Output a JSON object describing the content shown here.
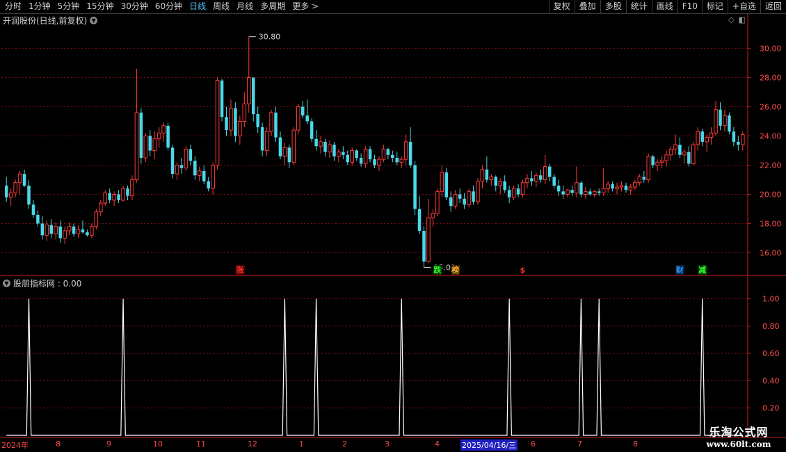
{
  "toolbar": {
    "periods": [
      "分时",
      "1分钟",
      "5分钟",
      "15分钟",
      "30分钟",
      "60分钟",
      "日线",
      "周线",
      "月线",
      "多周期",
      "更多 >"
    ],
    "active_period": "日线",
    "actions": [
      "复权",
      "叠加",
      "多股",
      "统计",
      "画线",
      "F10",
      "标记",
      "+自选",
      "返回"
    ]
  },
  "stock": {
    "title": "开润股份(日线,前复权)",
    "high_label": "30.80",
    "low_label": "15.01"
  },
  "indicator": {
    "title": "股朋指标网 : 0.00"
  },
  "price_axis": [
    "30.00",
    "28.00",
    "26.00",
    "24.00",
    "22.00",
    "20.00",
    "18.00",
    "16.00"
  ],
  "indicator_axis": [
    "1.00",
    "0.80",
    "0.60",
    "0.40",
    "0.20"
  ],
  "date_axis": [
    "2024年",
    "8",
    "9",
    "10",
    "11",
    "12",
    "1",
    "2",
    "3",
    "4",
    "2025/04/16/三",
    "6",
    "7",
    "8"
  ],
  "event_markers": [
    {
      "label": "涨",
      "color": "#ff3030",
      "bg": "#4a0000"
    },
    {
      "label": "跌",
      "color": "#30ff30",
      "bg": "#003a00"
    },
    {
      "label": "榜",
      "color": "#ffb030",
      "bg": "#3a2400"
    },
    {
      "label": "$",
      "color": "#ff3030",
      "bg": "#000000"
    },
    {
      "label": "财",
      "color": "#30a0ff",
      "bg": "#001a3a"
    },
    {
      "label": "减",
      "color": "#30ff30",
      "bg": "#003a00"
    }
  ],
  "watermark": {
    "line1": "乐淘公式网",
    "line2": "www.60lt.com"
  },
  "colors": {
    "up": "#ff3c3c",
    "down": "#4ad8e8",
    "grid": "#7a1010",
    "axis": "#c02020"
  },
  "chart_data": {
    "type": "candlestick",
    "y_range": [
      14.5,
      31.5
    ],
    "candles": [
      [
        20.6,
        21.2,
        19.5,
        19.8
      ],
      [
        19.8,
        20.4,
        19.2,
        20.1
      ],
      [
        20.1,
        21.0,
        19.8,
        20.8
      ],
      [
        20.8,
        21.6,
        20.0,
        21.4
      ],
      [
        21.4,
        21.7,
        20.5,
        20.6
      ],
      [
        20.6,
        21.0,
        19.0,
        19.3
      ],
      [
        19.3,
        19.6,
        18.4,
        18.6
      ],
      [
        18.6,
        18.9,
        17.8,
        18.0
      ],
      [
        18.0,
        18.5,
        16.9,
        17.2
      ],
      [
        17.2,
        18.2,
        16.8,
        17.9
      ],
      [
        17.9,
        18.3,
        17.0,
        17.3
      ],
      [
        17.3,
        18.1,
        16.9,
        17.8
      ],
      [
        17.8,
        18.2,
        16.7,
        17.0
      ],
      [
        17.0,
        17.8,
        16.6,
        17.5
      ],
      [
        17.5,
        18.1,
        17.2,
        17.8
      ],
      [
        17.8,
        18.0,
        17.1,
        17.3
      ],
      [
        17.3,
        17.9,
        17.0,
        17.6
      ],
      [
        17.6,
        18.2,
        17.3,
        17.4
      ],
      [
        17.4,
        17.6,
        17.1,
        17.2
      ],
      [
        17.2,
        18.0,
        17.0,
        17.8
      ],
      [
        17.8,
        19.0,
        17.6,
        18.8
      ],
      [
        18.8,
        19.6,
        18.5,
        19.4
      ],
      [
        19.4,
        20.3,
        19.2,
        20.1
      ],
      [
        20.1,
        20.4,
        19.4,
        19.6
      ],
      [
        19.6,
        20.2,
        19.2,
        20.0
      ],
      [
        20.0,
        20.3,
        19.4,
        19.6
      ],
      [
        19.6,
        20.6,
        19.5,
        20.4
      ],
      [
        20.4,
        20.6,
        19.6,
        19.9
      ],
      [
        19.9,
        21.3,
        19.6,
        21.0
      ],
      [
        21.0,
        28.6,
        20.8,
        25.6
      ],
      [
        25.6,
        25.9,
        22.1,
        22.5
      ],
      [
        22.5,
        24.2,
        22.2,
        24.0
      ],
      [
        24.0,
        24.4,
        22.6,
        23.0
      ],
      [
        23.0,
        24.3,
        22.4,
        23.8
      ],
      [
        23.8,
        24.6,
        23.2,
        24.2
      ],
      [
        24.2,
        24.9,
        23.6,
        24.7
      ],
      [
        24.7,
        24.9,
        23.0,
        23.2
      ],
      [
        23.2,
        23.4,
        21.1,
        21.4
      ],
      [
        21.4,
        22.2,
        21.0,
        22.0
      ],
      [
        22.0,
        22.5,
        21.4,
        21.8
      ],
      [
        21.8,
        23.3,
        21.6,
        23.1
      ],
      [
        23.1,
        23.4,
        22.0,
        22.3
      ],
      [
        22.3,
        22.6,
        21.0,
        21.3
      ],
      [
        21.3,
        21.9,
        20.9,
        21.6
      ],
      [
        21.6,
        22.0,
        20.7,
        20.9
      ],
      [
        20.9,
        21.2,
        20.2,
        20.4
      ],
      [
        20.4,
        22.2,
        20.0,
        22.0
      ],
      [
        22.0,
        28.0,
        21.7,
        27.8
      ],
      [
        27.8,
        27.9,
        25.0,
        25.3
      ],
      [
        25.3,
        26.0,
        24.0,
        24.4
      ],
      [
        24.4,
        26.5,
        24.0,
        25.9
      ],
      [
        25.9,
        26.3,
        23.6,
        24.0
      ],
      [
        24.0,
        25.4,
        23.4,
        25.0
      ],
      [
        25.0,
        27.0,
        24.6,
        26.2
      ],
      [
        26.2,
        30.8,
        25.6,
        28.0
      ],
      [
        28.0,
        28.0,
        25.0,
        25.5
      ],
      [
        25.5,
        26.0,
        24.2,
        24.6
      ],
      [
        24.6,
        24.9,
        22.6,
        23.0
      ],
      [
        23.0,
        24.6,
        22.6,
        24.3
      ],
      [
        24.3,
        25.8,
        24.0,
        25.6
      ],
      [
        25.6,
        26.0,
        23.6,
        23.9
      ],
      [
        23.9,
        24.3,
        22.4,
        22.6
      ],
      [
        22.6,
        23.5,
        22.0,
        23.2
      ],
      [
        23.2,
        23.4,
        21.8,
        22.2
      ],
      [
        22.2,
        24.6,
        22.0,
        24.4
      ],
      [
        24.4,
        26.2,
        24.1,
        26.0
      ],
      [
        26.0,
        26.4,
        25.2,
        25.4
      ],
      [
        25.4,
        26.5,
        24.8,
        25.0
      ],
      [
        25.0,
        25.2,
        23.6,
        23.8
      ],
      [
        23.8,
        24.4,
        23.0,
        23.3
      ],
      [
        23.3,
        24.0,
        22.8,
        23.6
      ],
      [
        23.6,
        23.8,
        22.6,
        22.9
      ],
      [
        22.9,
        23.7,
        22.5,
        23.4
      ],
      [
        23.4,
        23.6,
        22.3,
        22.6
      ],
      [
        22.6,
        23.1,
        22.2,
        22.9
      ],
      [
        22.9,
        23.3,
        22.4,
        22.7
      ],
      [
        22.7,
        23.0,
        22.0,
        22.2
      ],
      [
        22.2,
        23.2,
        22.0,
        23.0
      ],
      [
        23.0,
        23.1,
        22.3,
        22.5
      ],
      [
        22.5,
        22.8,
        21.9,
        22.1
      ],
      [
        22.1,
        23.3,
        21.8,
        23.1
      ],
      [
        23.1,
        23.3,
        22.2,
        22.4
      ],
      [
        22.4,
        22.7,
        21.8,
        22.0
      ],
      [
        22.0,
        22.6,
        21.6,
        22.4
      ],
      [
        22.4,
        23.4,
        22.2,
        23.1
      ],
      [
        23.1,
        23.2,
        22.4,
        22.7
      ],
      [
        22.7,
        23.0,
        22.2,
        22.5
      ],
      [
        22.5,
        22.9,
        22.0,
        22.2
      ],
      [
        22.2,
        22.6,
        21.8,
        22.4
      ],
      [
        22.4,
        24.1,
        22.0,
        23.6
      ],
      [
        23.6,
        24.6,
        21.8,
        22.0
      ],
      [
        22.0,
        22.3,
        18.6,
        19.0
      ],
      [
        19.0,
        19.9,
        17.3,
        17.5
      ],
      [
        17.5,
        17.8,
        15.0,
        15.4
      ],
      [
        15.4,
        19.7,
        15.3,
        18.4
      ],
      [
        18.4,
        19.0,
        17.8,
        18.7
      ],
      [
        18.7,
        20.4,
        18.5,
        20.2
      ],
      [
        20.2,
        22.0,
        19.8,
        21.5
      ],
      [
        21.5,
        21.8,
        19.6,
        19.8
      ],
      [
        19.8,
        20.2,
        18.8,
        19.2
      ],
      [
        19.2,
        20.3,
        19.0,
        20.0
      ],
      [
        20.0,
        20.4,
        19.4,
        19.7
      ],
      [
        19.7,
        20.1,
        19.0,
        19.3
      ],
      [
        19.3,
        20.4,
        19.1,
        20.2
      ],
      [
        20.2,
        20.6,
        19.3,
        19.5
      ],
      [
        19.5,
        21.1,
        19.3,
        20.9
      ],
      [
        20.9,
        22.0,
        20.4,
        21.7
      ],
      [
        21.7,
        22.6,
        20.8,
        21.0
      ],
      [
        21.0,
        21.4,
        20.6,
        21.2
      ],
      [
        21.2,
        21.3,
        20.2,
        20.6
      ],
      [
        20.6,
        21.1,
        20.0,
        20.9
      ],
      [
        20.9,
        21.3,
        20.1,
        20.3
      ],
      [
        20.3,
        20.6,
        19.4,
        19.8
      ],
      [
        19.8,
        20.6,
        19.6,
        20.4
      ],
      [
        20.4,
        20.7,
        19.8,
        20.0
      ],
      [
        20.0,
        21.0,
        19.8,
        20.8
      ],
      [
        20.8,
        21.4,
        20.4,
        21.1
      ],
      [
        21.1,
        21.6,
        20.6,
        20.9
      ],
      [
        20.9,
        21.5,
        20.5,
        21.3
      ],
      [
        21.3,
        21.7,
        20.8,
        21.0
      ],
      [
        21.0,
        22.7,
        20.7,
        21.9
      ],
      [
        21.9,
        22.1,
        20.9,
        21.2
      ],
      [
        21.2,
        21.4,
        20.4,
        20.6
      ],
      [
        20.6,
        21.0,
        19.9,
        20.2
      ],
      [
        20.2,
        20.6,
        19.7,
        20.0
      ],
      [
        20.0,
        20.4,
        19.8,
        20.3
      ],
      [
        20.3,
        20.6,
        19.9,
        20.1
      ],
      [
        20.1,
        21.9,
        19.8,
        20.8
      ],
      [
        20.8,
        20.9,
        19.8,
        20.0
      ],
      [
        20.0,
        20.5,
        19.7,
        20.2
      ],
      [
        20.2,
        20.4,
        19.9,
        20.0
      ],
      [
        20.0,
        20.3,
        19.8,
        20.2
      ],
      [
        20.2,
        20.4,
        19.9,
        20.1
      ],
      [
        20.1,
        21.8,
        19.9,
        20.4
      ],
      [
        20.4,
        20.9,
        20.1,
        20.7
      ],
      [
        20.7,
        20.9,
        20.2,
        20.4
      ],
      [
        20.4,
        20.8,
        20.0,
        20.5
      ],
      [
        20.5,
        20.9,
        20.2,
        20.6
      ],
      [
        20.6,
        20.8,
        20.1,
        20.3
      ],
      [
        20.3,
        20.7,
        20.0,
        20.5
      ],
      [
        20.5,
        21.0,
        20.3,
        20.8
      ],
      [
        20.8,
        21.4,
        20.6,
        21.2
      ],
      [
        21.2,
        21.6,
        20.8,
        21.0
      ],
      [
        21.0,
        22.8,
        20.8,
        22.6
      ],
      [
        22.6,
        22.7,
        21.8,
        22.0
      ],
      [
        22.0,
        22.4,
        21.6,
        22.2
      ],
      [
        22.2,
        22.6,
        21.8,
        22.3
      ],
      [
        22.3,
        23.0,
        21.9,
        22.7
      ],
      [
        22.7,
        23.3,
        22.3,
        23.1
      ],
      [
        23.1,
        24.1,
        22.7,
        23.4
      ],
      [
        23.4,
        23.9,
        22.5,
        22.7
      ],
      [
        22.7,
        23.1,
        22.1,
        22.9
      ],
      [
        22.9,
        23.3,
        21.9,
        22.1
      ],
      [
        22.1,
        23.6,
        22.0,
        23.4
      ],
      [
        23.4,
        24.6,
        23.0,
        24.3
      ],
      [
        24.3,
        24.5,
        23.3,
        23.6
      ],
      [
        23.6,
        24.1,
        22.9,
        23.9
      ],
      [
        23.9,
        24.6,
        23.4,
        24.2
      ],
      [
        24.2,
        26.4,
        24.0,
        25.8
      ],
      [
        25.8,
        26.3,
        24.4,
        24.7
      ],
      [
        24.7,
        25.8,
        24.3,
        25.4
      ],
      [
        25.4,
        25.6,
        24.1,
        24.3
      ],
      [
        24.3,
        24.6,
        23.3,
        23.6
      ],
      [
        23.6,
        24.0,
        23.0,
        23.4
      ],
      [
        23.4,
        24.3,
        23.0,
        24.1
      ]
    ],
    "indicator_type": "line",
    "indicator_y_range": [
      0,
      1.1
    ],
    "indicator_spikes_at_candle": [
      5,
      26,
      62,
      69,
      88,
      112,
      128,
      132,
      155
    ],
    "indicator_spike_value": 1.0
  }
}
